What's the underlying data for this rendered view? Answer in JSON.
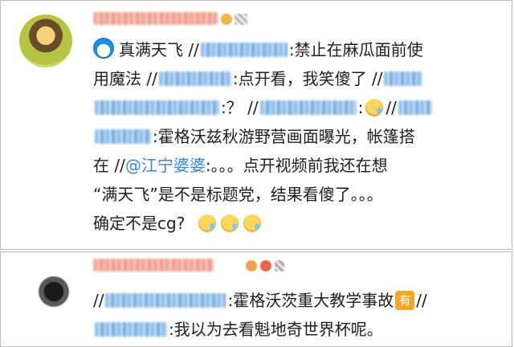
{
  "comment1": {
    "line1": "真满天飞 //",
    "line1b": ":禁止在麻瓜面前使",
    "line2": "用魔法 //",
    "line2b": ":点开看，我笑傻了 //",
    "line3b": ":？ //",
    "line3c": ":",
    "line3d": "//",
    "line4b": ":霍格沃兹秋游野营画面曝光，帐篷搭",
    "line5": "在 //",
    "line5_link": "@江宁婆婆",
    "line5b": ":。。。点开视频前我还在想",
    "line6": "“满天飞”是不是标题党，结果看傻了。。。",
    "line7": "确定不是cg?"
  },
  "comment2": {
    "line1": "//",
    "line1b": ":霍格沃茨重大教学事故",
    "badge_text": "有",
    "line1c": "//",
    "line2b": ":我以为去看魁地奇世界杯呢。"
  }
}
